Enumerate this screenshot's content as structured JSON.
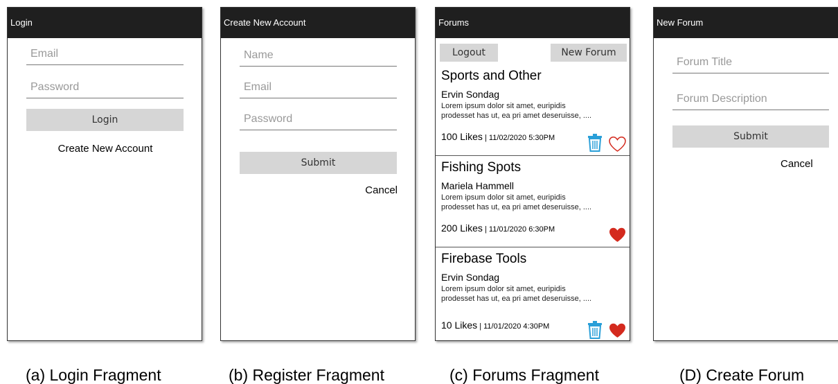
{
  "login": {
    "title": "Login",
    "email_placeholder": "Email",
    "password_placeholder": "Password",
    "login_button": "Login",
    "create_account_link": "Create New Account",
    "caption": "(a) Login Fragment"
  },
  "register": {
    "title": "Create New Account",
    "name_placeholder": "Name",
    "email_placeholder": "Email",
    "password_placeholder": "Password",
    "submit_button": "Submit",
    "cancel_link": "Cancel",
    "caption": "(b) Register Fragment"
  },
  "forums": {
    "title": "Forums",
    "logout_button": "Logout",
    "new_forum_button": "New Forum",
    "caption": "(c) Forums Fragment",
    "items": [
      {
        "title": "Sports and Other",
        "author": "Ervin Sondag",
        "description_line1": "Lorem ipsum dolor sit amet, euripidis",
        "description_line2": "prodesset has ut, ea pri amet deseruisse, ....",
        "likes": "100 Likes",
        "date": " | 11/02/2020 5:30PM",
        "heart": "heart-outline-icon",
        "deletable": true
      },
      {
        "title": "Fishing Spots",
        "author": "Mariela Hammell",
        "description_line1": "Lorem ipsum dolor sit amet, euripidis",
        "description_line2": "prodesset has ut, ea pri amet deseruisse, ....",
        "likes": "200 Likes",
        "date": " | 11/01/2020 6:30PM",
        "heart": "heart-filled-icon",
        "deletable": false
      },
      {
        "title": "Firebase Tools",
        "author": "Ervin Sondag",
        "description_line1": "Lorem ipsum dolor sit amet, euripidis",
        "description_line2": "prodesset has ut, ea pri amet deseruisse, ....",
        "likes": "10 Likes",
        "date": " | 11/01/2020 4:30PM",
        "heart": "heart-filled-icon",
        "deletable": true
      }
    ]
  },
  "new_forum": {
    "title": "New Forum",
    "title_placeholder": "Forum Title",
    "description_placeholder": "Forum Description",
    "submit_button": "Submit",
    "cancel_link": "Cancel",
    "caption": "(D) Create Forum"
  },
  "colors": {
    "titlebar": "#1f1f1f",
    "button": "#d6d6d6",
    "heart": "#d42a1e",
    "trash": "#2a9fd8"
  }
}
